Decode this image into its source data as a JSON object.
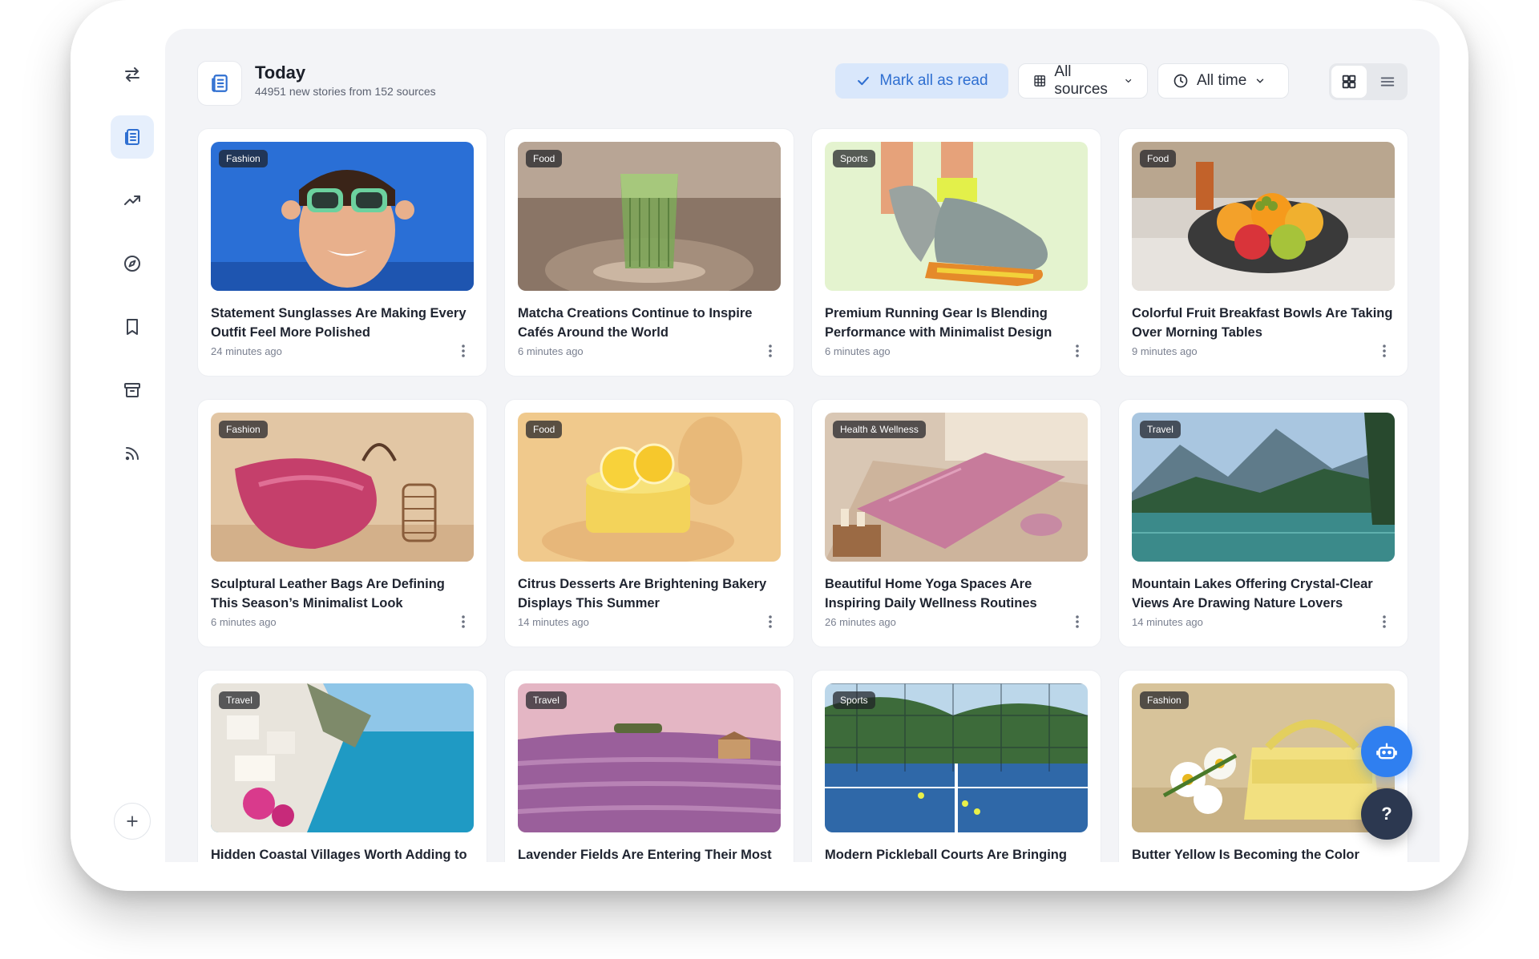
{
  "header": {
    "title": "Today",
    "subtitle": "44951 new stories from 152 sources",
    "mark_all_label": "Mark all as read",
    "sources_label": "All sources",
    "time_label": "All time",
    "view_mode": "grid"
  },
  "sidebar": {
    "items": [
      {
        "icon": "swap-arrows-icon",
        "active": false
      },
      {
        "icon": "newspaper-icon",
        "active": true
      },
      {
        "icon": "trending-icon",
        "active": false
      },
      {
        "icon": "compass-icon",
        "active": false
      },
      {
        "icon": "bookmark-icon",
        "active": false
      },
      {
        "icon": "archive-icon",
        "active": false
      },
      {
        "icon": "rss-icon",
        "active": false
      }
    ],
    "add_icon": "plus-icon"
  },
  "colors": {
    "accent": "#2f6fd1",
    "accent_light": "#d9e7fb",
    "fab_primary": "#2f7ff0",
    "fab_dark": "#2c3850",
    "background": "#f3f4f7"
  },
  "cards": [
    {
      "tag": "Fashion",
      "title": "Statement Sunglasses Are Making Every Outfit Feel More Polished",
      "time": "24 minutes ago"
    },
    {
      "tag": "Food",
      "title": "Matcha Creations Continue to Inspire Cafés Around the World",
      "time": "6 minutes ago"
    },
    {
      "tag": "Sports",
      "title": "Premium Running Gear Is Blending Performance with Minimalist Design",
      "time": "6 minutes ago"
    },
    {
      "tag": "Food",
      "title": "Colorful Fruit Breakfast Bowls Are Taking Over Morning Tables",
      "time": "9 minutes ago"
    },
    {
      "tag": "Fashion",
      "title": "Sculptural Leather Bags Are Defining This Season’s Minimalist Look",
      "time": "6 minutes ago"
    },
    {
      "tag": "Food",
      "title": "Citrus Desserts Are Brightening Bakery Displays This Summer",
      "time": "14 minutes ago"
    },
    {
      "tag": "Health & Wellness",
      "title": "Beautiful Home Yoga Spaces Are Inspiring Daily Wellness Routines",
      "time": "26 minutes ago"
    },
    {
      "tag": "Travel",
      "title": "Mountain Lakes Offering Crystal-Clear Views Are Drawing Nature Lovers",
      "time": "14 minutes ago"
    },
    {
      "tag": "Travel",
      "title": "Hidden Coastal Villages Worth Adding to",
      "time": ""
    },
    {
      "tag": "Travel",
      "title": "Lavender Fields Are Entering Their Most",
      "time": ""
    },
    {
      "tag": "Sports",
      "title": "Modern Pickleball Courts Are Bringing",
      "time": ""
    },
    {
      "tag": "Fashion",
      "title": "Butter Yellow Is Becoming the Color",
      "time": ""
    }
  ],
  "fab": {
    "assistant_icon": "robot-icon",
    "help_label": "?"
  }
}
